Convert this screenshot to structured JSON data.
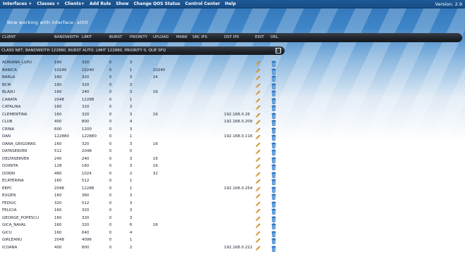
{
  "menu": {
    "items": [
      "Interfaces +",
      "Classes +",
      "Clients+",
      "Add Rule",
      "Show",
      "Change QOS Status",
      "Control Center",
      "Help"
    ],
    "version": "Version: 2.9"
  },
  "interface": {
    "label": "Now working with interface:",
    "name": "eth0"
  },
  "table": {
    "headers": {
      "client": "CLIENT",
      "bandwidth": "BANDWIDTH",
      "limit": "LIMIT",
      "burst": "BURST",
      "priority": "PRIORITY",
      "upload": "UPLOAD",
      "mark": "MARK",
      "src_ips": "SRC IPS",
      "dst_ips": "DST IPS",
      "edit": "EDIT",
      "del": "DEL"
    },
    "class_bar": {
      "text": "CLASS NET, BANDWIDTH 122880, BURST AUTO, LIMIT 122880, PRIORITY 0, QUE SFQ",
      "toggle": "[-]"
    },
    "rows": [
      {
        "client": "ADRIANA_LUPU",
        "bandwidth": "160",
        "limit": "320",
        "burst": "0",
        "priority": "3",
        "upload": "",
        "dst": ""
      },
      {
        "client": "BANICA",
        "bandwidth": "10240",
        "limit": "10240",
        "burst": "0",
        "priority": "1",
        "upload": "10240",
        "dst": ""
      },
      {
        "client": "BARLA",
        "bandwidth": "160",
        "limit": "320",
        "burst": "0",
        "priority": "3",
        "upload": "24",
        "dst": ""
      },
      {
        "client": "BCM",
        "bandwidth": "160",
        "limit": "320",
        "burst": "0",
        "priority": "3",
        "upload": "",
        "dst": ""
      },
      {
        "client": "BLAJIU",
        "bandwidth": "160",
        "limit": "240",
        "burst": "0",
        "priority": "3",
        "upload": "16",
        "dst": ""
      },
      {
        "client": "CARATA",
        "bandwidth": "2048",
        "limit": "12288",
        "burst": "0",
        "priority": "1",
        "upload": "",
        "dst": ""
      },
      {
        "client": "CATALINA",
        "bandwidth": "160",
        "limit": "320",
        "burst": "0",
        "priority": "3",
        "upload": "",
        "dst": ""
      },
      {
        "client": "CLEMENTINA",
        "bandwidth": "160",
        "limit": "320",
        "burst": "0",
        "priority": "3",
        "upload": "16",
        "dst": "192.168.0.26"
      },
      {
        "client": "CLUB",
        "bandwidth": "400",
        "limit": "800",
        "burst": "0",
        "priority": "4",
        "upload": "",
        "dst": "192.168.0.209"
      },
      {
        "client": "CRINA",
        "bandwidth": "600",
        "limit": "1200",
        "burst": "0",
        "priority": "3",
        "upload": "",
        "dst": ""
      },
      {
        "client": "DAN",
        "bandwidth": "122880",
        "limit": "122880",
        "burst": "0",
        "priority": "1",
        "upload": "",
        "dst": "192.168.0.116"
      },
      {
        "client": "DANA_GRIGORAS",
        "bandwidth": "160",
        "limit": "320",
        "burst": "0",
        "priority": "3",
        "upload": "16",
        "dst": ""
      },
      {
        "client": "DATASERVER",
        "bandwidth": "512",
        "limit": "2048",
        "burst": "0",
        "priority": "0",
        "upload": "",
        "dst": ""
      },
      {
        "client": "DELTASERVER",
        "bandwidth": "240",
        "limit": "240",
        "burst": "0",
        "priority": "3",
        "upload": "16",
        "dst": ""
      },
      {
        "client": "DOINITA",
        "bandwidth": "128",
        "limit": "160",
        "burst": "0",
        "priority": "3",
        "upload": "16",
        "dst": ""
      },
      {
        "client": "DORIN",
        "bandwidth": "480",
        "limit": "1024",
        "burst": "0",
        "priority": "2",
        "upload": "32",
        "dst": ""
      },
      {
        "client": "ECATERINA",
        "bandwidth": "160",
        "limit": "512",
        "burst": "0",
        "priority": "1",
        "upload": "",
        "dst": ""
      },
      {
        "client": "EEPC",
        "bandwidth": "2048",
        "limit": "12288",
        "burst": "0",
        "priority": "1",
        "upload": "",
        "dst": "192.168.0.254"
      },
      {
        "client": "EUGEN",
        "bandwidth": "160",
        "limit": "360",
        "burst": "0",
        "priority": "3",
        "upload": "",
        "dst": ""
      },
      {
        "client": "FEDIUC",
        "bandwidth": "320",
        "limit": "512",
        "burst": "0",
        "priority": "3",
        "upload": "",
        "dst": ""
      },
      {
        "client": "FELICIA",
        "bandwidth": "160",
        "limit": "320",
        "burst": "0",
        "priority": "3",
        "upload": "",
        "dst": ""
      },
      {
        "client": "GEORGE_POPESCU",
        "bandwidth": "160",
        "limit": "320",
        "burst": "0",
        "priority": "3",
        "upload": "",
        "dst": ""
      },
      {
        "client": "GICA_NAVAL",
        "bandwidth": "160",
        "limit": "320",
        "burst": "0",
        "priority": "6",
        "upload": "16",
        "dst": ""
      },
      {
        "client": "GICU",
        "bandwidth": "160",
        "limit": "640",
        "burst": "0",
        "priority": "4",
        "upload": "",
        "dst": ""
      },
      {
        "client": "GIRLEANU",
        "bandwidth": "2048",
        "limit": "4096",
        "burst": "0",
        "priority": "1",
        "upload": "",
        "dst": ""
      },
      {
        "client": "ICOANA",
        "bandwidth": "400",
        "limit": "800",
        "burst": "0",
        "priority": "2",
        "upload": "",
        "dst": "192.168.0.222"
      }
    ]
  },
  "icons": {
    "edit": "pencil-icon",
    "delete": "trash-icon"
  },
  "colors": {
    "menu_bar": "#1e5a98",
    "header_dark": "#1f232a",
    "pencil": "#e39a22",
    "trash": "#2f7fd0"
  }
}
